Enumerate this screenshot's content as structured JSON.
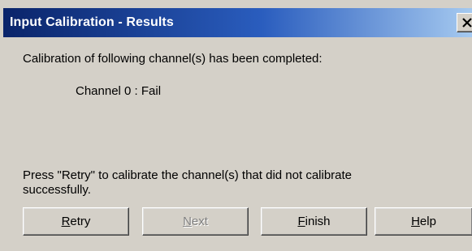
{
  "window": {
    "title": "Input Calibration - Results",
    "close_label": "Close"
  },
  "message": {
    "heading": "Calibration of following channel(s) has been completed:",
    "channel_result": "Channel 0 : Fail",
    "instruction_line1": "Press \"Retry\" to calibrate the channel(s) that did not calibrate",
    "instruction_line2": "successfully."
  },
  "buttons": {
    "retry": {
      "accel": "R",
      "rest": "etry",
      "enabled": true
    },
    "next": {
      "accel": "N",
      "rest": "ext",
      "enabled": false
    },
    "finish": {
      "accel": "F",
      "rest": "inish",
      "enabled": true
    },
    "help": {
      "accel": "H",
      "rest": "elp",
      "enabled": true
    }
  },
  "colors": {
    "title_gradient_start": "#0a246a",
    "title_gradient_end": "#a6caf0",
    "face": "#d4d0c8",
    "disabled_text": "#808080"
  }
}
